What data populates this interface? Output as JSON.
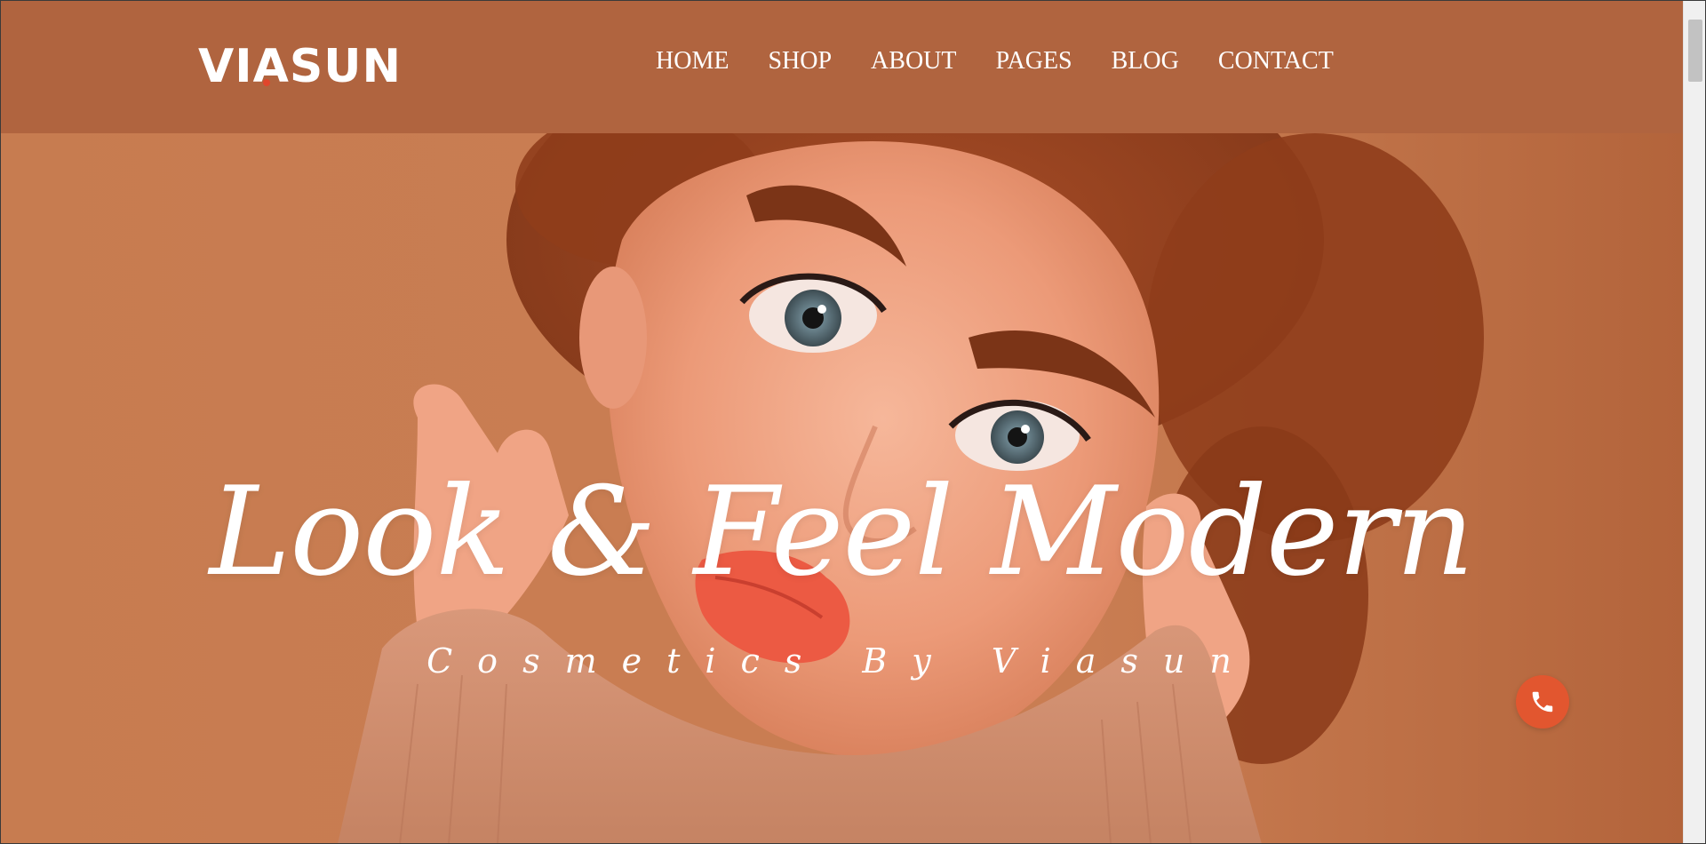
{
  "brand": {
    "logo_text": "VIASUN"
  },
  "nav": {
    "items": [
      {
        "label": "HOME"
      },
      {
        "label": "SHOP"
      },
      {
        "label": "ABOUT"
      },
      {
        "label": "PAGES"
      },
      {
        "label": "BLOG"
      },
      {
        "label": "CONTACT"
      }
    ]
  },
  "hero": {
    "headline": "Look & Feel Modern",
    "subline": "Cosmetics By Viasun"
  },
  "call_button": {
    "icon": "phone-icon"
  },
  "colors": {
    "header_bg": "#b0643f",
    "hero_bg": "#c97d52",
    "accent": "#e2562f",
    "text": "#ffffff"
  }
}
